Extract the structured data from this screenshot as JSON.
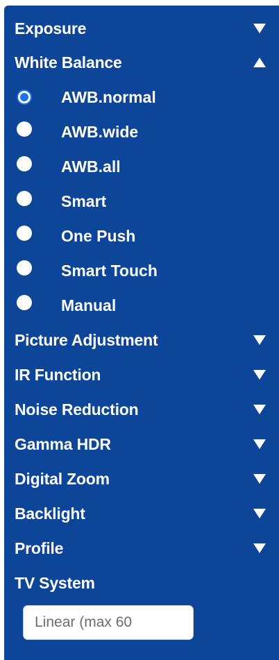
{
  "sections": {
    "exposure": {
      "label": "Exposure",
      "state": "collapsed"
    },
    "white_balance": {
      "label": "White Balance",
      "state": "expanded",
      "options": [
        {
          "label": "AWB.normal",
          "checked": true
        },
        {
          "label": "AWB.wide",
          "checked": false
        },
        {
          "label": "AWB.all",
          "checked": false
        },
        {
          "label": "Smart",
          "checked": false
        },
        {
          "label": "One Push",
          "checked": false
        },
        {
          "label": "Smart Touch",
          "checked": false
        },
        {
          "label": "Manual",
          "checked": false
        }
      ]
    },
    "picture_adjustment": {
      "label": "Picture Adjustment",
      "state": "collapsed"
    },
    "ir_function": {
      "label": "IR Function",
      "state": "collapsed"
    },
    "noise_reduction": {
      "label": "Noise Reduction",
      "state": "collapsed"
    },
    "gamma_hdr": {
      "label": "Gamma HDR",
      "state": "collapsed"
    },
    "digital_zoom": {
      "label": "Digital Zoom",
      "state": "collapsed"
    },
    "backlight": {
      "label": "Backlight",
      "state": "collapsed"
    },
    "profile": {
      "label": "Profile",
      "state": "collapsed"
    },
    "tv_system": {
      "label": "TV System",
      "input": {
        "value": "",
        "placeholder": "Linear (max 60"
      }
    }
  },
  "icons": {
    "collapsed": "triangle-down-icon",
    "expanded": "triangle-up-icon"
  },
  "colors": {
    "panel_background": "#0d4598",
    "text": "#ffffff",
    "radio_selected": "#1a73e8"
  }
}
